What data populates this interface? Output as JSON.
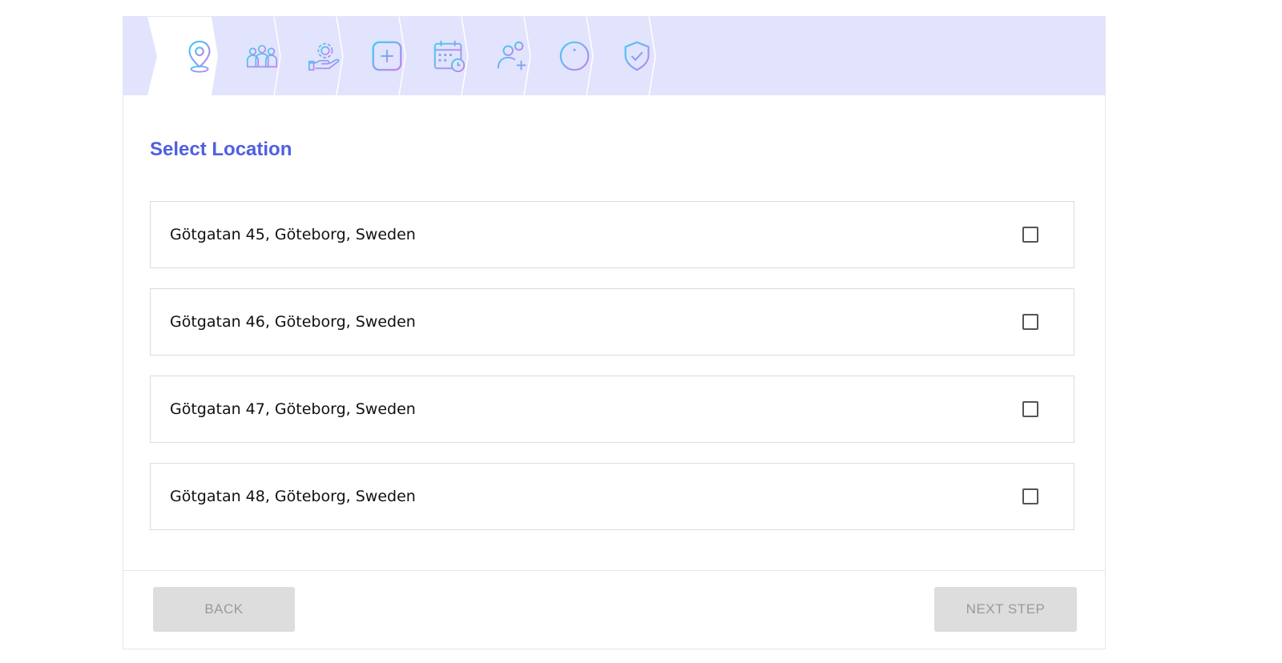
{
  "stepper": {
    "steps": [
      {
        "id": "location",
        "icon": "location-pin-icon",
        "active": true
      },
      {
        "id": "team",
        "icon": "team-group-icon",
        "active": false
      },
      {
        "id": "service",
        "icon": "service-hand-gear-icon",
        "active": false
      },
      {
        "id": "extras",
        "icon": "plus-square-icon",
        "active": false
      },
      {
        "id": "schedule",
        "icon": "calendar-clock-icon",
        "active": false
      },
      {
        "id": "add-user",
        "icon": "user-add-icon",
        "active": false
      },
      {
        "id": "info",
        "icon": "info-circle-icon",
        "active": false
      },
      {
        "id": "confirm",
        "icon": "shield-check-icon",
        "active": false
      }
    ],
    "colors": {
      "bar": "#e2e3fc",
      "gradient_start": "#35d0f0",
      "gradient_end": "#c77ef0"
    }
  },
  "main": {
    "title": "Select Location",
    "locations": [
      {
        "label": "Götgatan 45, Göteborg, Sweden",
        "checked": false
      },
      {
        "label": "Götgatan 46, Göteborg, Sweden",
        "checked": false
      },
      {
        "label": "Götgatan 47, Göteborg, Sweden",
        "checked": false
      },
      {
        "label": "Götgatan 48, Göteborg, Sweden",
        "checked": false
      }
    ]
  },
  "footer": {
    "back_label": "BACK",
    "next_label": "NEXT STEP"
  }
}
